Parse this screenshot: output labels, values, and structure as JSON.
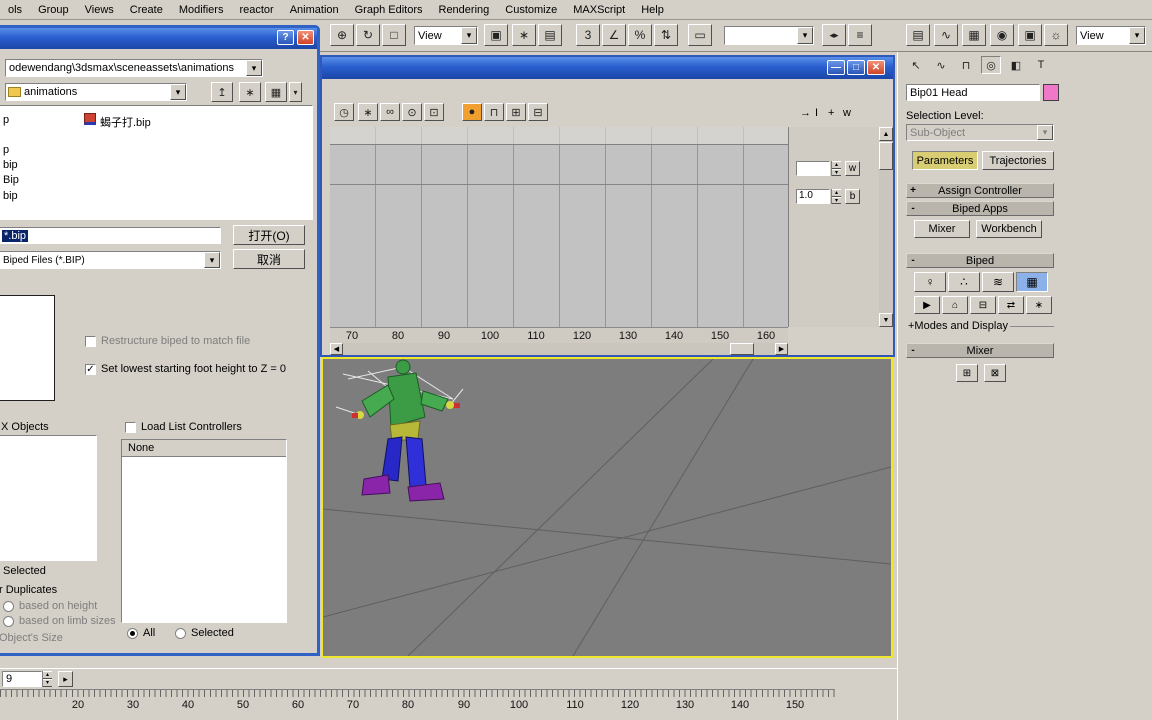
{
  "menu": {
    "items": [
      "ols",
      "Group",
      "Views",
      "Create",
      "Modifiers",
      "reactor",
      "Animation",
      "Graph Editors",
      "Rendering",
      "Customize",
      "MAXScript",
      "Help"
    ]
  },
  "toolbar": {
    "view_left": "View",
    "view_right": "View"
  },
  "icons": {
    "move": "⊕",
    "rotate": "↻",
    "scale": "□",
    "use_center": "▣",
    "manipulate": "∗",
    "keyboard": "▤",
    "snap3": "3",
    "angle_snap": "∠",
    "percent_snap": "%",
    "spinner_snap": "⇅",
    "named_sets": "▭",
    "mirror": "◂▸",
    "align": "≡",
    "layer_manager": "▤",
    "curve_editor": "∿",
    "schematic_view": "▦",
    "material_editor": "◉",
    "render_setup": "▣",
    "quick_render": "☼",
    "dropdown_arrow": "▾",
    "clock": "◷",
    "pan_hand": "∗",
    "key_range": "∞",
    "zoom": "⊙",
    "zoom_region": "⊡",
    "snap_key": "●",
    "lock_keys": "⊓",
    "grid_a": "⊞",
    "grid_b": "⊟",
    "arrow_right": "→",
    "cursor_i": "I",
    "plus": "+",
    "up_folder": "↥",
    "new_folder": "∗",
    "view_menu": "▦",
    "tab_create": "↖",
    "tab_modify": "∿",
    "tab_hierarchy": "⊓",
    "tab_motion": "◎",
    "tab_display": "◧",
    "tab_utilities": "T",
    "figure_mode": "♀",
    "footstep_mode": "∴",
    "motion_flow": "≋",
    "mixer_mode": "▦",
    "biped_play": "▶",
    "load_file": "⌂",
    "save_file": "⊟",
    "convert": "⇄",
    "move_all": "∗",
    "mixer_a": "⊞",
    "mixer_b": "⊠",
    "spin_up": "▴",
    "spin_down": "▾",
    "scroll_up": "▲",
    "scroll_down": "▼",
    "scroll_left": "◀",
    "scroll_right": "▶",
    "check": "✓",
    "help": "?",
    "close": "✕",
    "minimize": "—",
    "maximize": "□",
    "next_frame": "▸"
  },
  "dialog": {
    "path": "odewendang\\3dsmax\\sceneassets\\animations",
    "folder": "animations",
    "files": {
      "row0_left": "p",
      "main": "蝎子打.bip",
      "col": [
        "p",
        "bip",
        "Bip",
        "bip"
      ]
    },
    "filename": "*.bip",
    "open_label": "打开(O)",
    "cancel_label": "取消",
    "filetype": "Biped Files (*.BIP)",
    "chk_restructure": "Restructure biped to match file",
    "chk_foot": "Set lowest starting foot height to Z = 0",
    "objects_label": "X Objects",
    "load_list_label": "Load List Controllers",
    "none_label": "None",
    "selected_label": "Selected",
    "duplicates_label": "r Duplicates",
    "radio_height": "based on height",
    "radio_limb": "based on limb sizes",
    "objsize_label": "Object's Size",
    "radio_all": "All",
    "radio_selected": "Selected"
  },
  "track": {
    "value1": "",
    "value2": "1.0",
    "w_label": "w",
    "b_label": "b",
    "ruler": [
      "70",
      "80",
      "90",
      "100",
      "110",
      "120",
      "130",
      "140",
      "150",
      "160"
    ]
  },
  "panel": {
    "object_name": "Bip01 Head",
    "selection_level": "Selection Level:",
    "sub_object": "Sub-Object",
    "tab_parameters": "Parameters",
    "tab_trajectories": "Trajectories",
    "rollout_assign": "Assign Controller",
    "rollout_biped_apps": "Biped Apps",
    "btn_mixer": "Mixer",
    "btn_workbench": "Workbench",
    "rollout_biped": "Biped",
    "modes_label": "+Modes and Display",
    "rollout_mixer": "Mixer"
  },
  "timeline": {
    "frame": "9",
    "ticks": [
      "20",
      "30",
      "40",
      "50",
      "60",
      "70",
      "80",
      "90",
      "100",
      "110",
      "120",
      "130",
      "140",
      "150"
    ]
  },
  "colors": {
    "title_accent": "#2a5ecf",
    "viewport_border": "#efe72c",
    "selection": "#0a246a",
    "active_tab": "#d8cd72",
    "active_tool": "#8cb0e8",
    "swatch_pink": "#f078c8",
    "key_highlight": "#f0a030"
  }
}
